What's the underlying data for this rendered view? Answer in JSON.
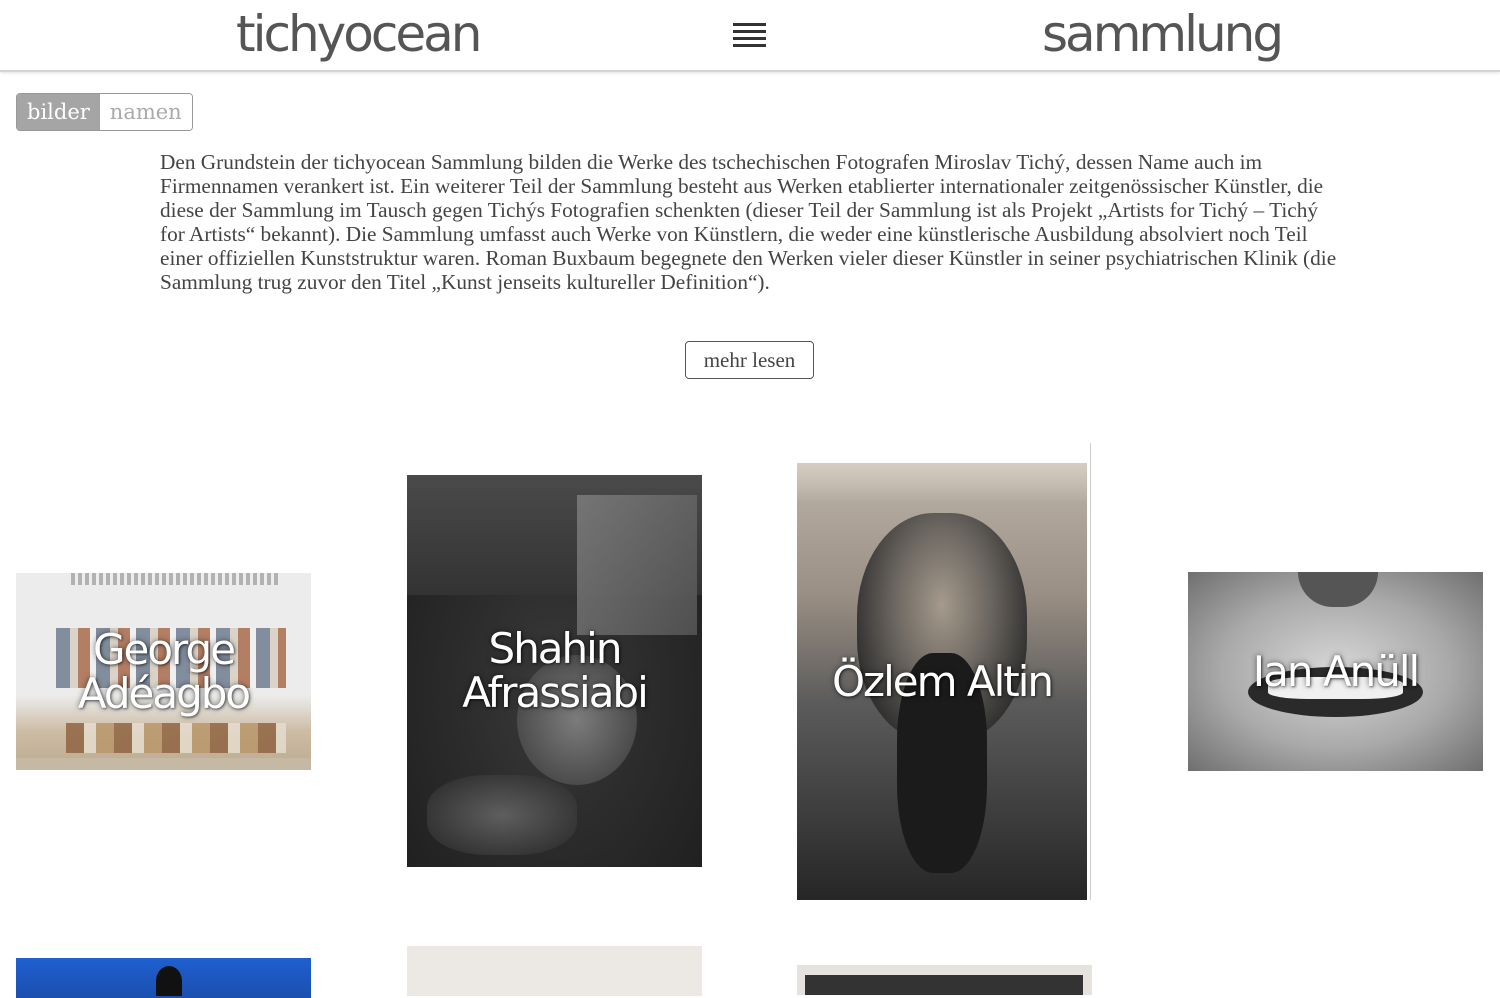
{
  "header": {
    "logo": "tichyocean",
    "section": "sammlung",
    "menu_icon": "hamburger-menu-icon"
  },
  "view_toggle": {
    "bilder": "bilder",
    "namen": "namen",
    "active": "bilder"
  },
  "intro": {
    "text": "Den Grundstein der tichyocean Sammlung bilden die Werke des tschechischen Fotografen Miroslav Tichý, dessen Name auch im Firmennamen verankert ist. Ein weiterer Teil der Sammlung besteht aus Werken etablierter internationaler zeitgenössischer Künstler, die diese der Sammlung im Tausch gegen Tichýs Fotografien schenkten (dieser Teil der Sammlung ist als Projekt „Artists for Tichý – Tichý for Artists“ bekannt). Die Sammlung umfasst auch Werke von Künstlern, die weder eine künstlerische Ausbildung absolviert noch Teil einer offiziellen Kunststruktur waren. Roman Buxbaum begegnete den Werken vieler dieser Künstler in seiner psychiatrischen Klinik (die Sammlung trug zuvor den Titel „Kunst jenseits kultureller Definition“).",
    "more_label": "mehr lesen"
  },
  "artists": [
    {
      "name": "George Adéagbo"
    },
    {
      "name": "Shahin Afrassiabi"
    },
    {
      "name": "Özlem Altin"
    },
    {
      "name": "Ian Anüll"
    }
  ],
  "colors": {
    "toggle_active": "#a5a5a5",
    "text": "#444444",
    "header_border": "#d5d5d5"
  }
}
